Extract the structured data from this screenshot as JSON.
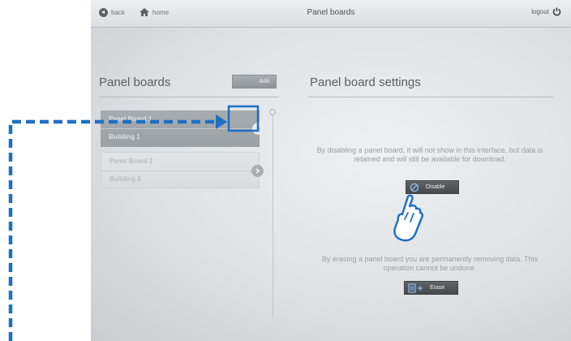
{
  "topbar": {
    "back_label": "back",
    "home_label": "home",
    "title": "Panel boards",
    "logout_label": "logout"
  },
  "left_panel": {
    "title": "Panel boards",
    "add_label": "Add",
    "items": [
      {
        "name": "Panel Board 1",
        "building": "Building 1",
        "selected": true
      },
      {
        "name": "Panel Board 2",
        "building": "Building 2",
        "selected": false
      }
    ]
  },
  "right_panel": {
    "title": "Panel board settings",
    "disable_description": "By disabling a panel board, it will not show in this interface, but data is retained and will still be available for download.",
    "disable_label": "Disable",
    "erase_description": "By erasing a panel board you are permanently removing data. This operation cannot be undone.",
    "erase_label": "Erase"
  },
  "annotation": {
    "callout_color": "#1f6fc4",
    "pointer": "hand-pointer-icon"
  },
  "icons": {
    "back": "back-arrow-icon",
    "home": "home-icon",
    "logout": "power-icon",
    "chevron": "chevron-right-icon",
    "disable": "prohibited-icon",
    "erase": "erase-icon"
  }
}
